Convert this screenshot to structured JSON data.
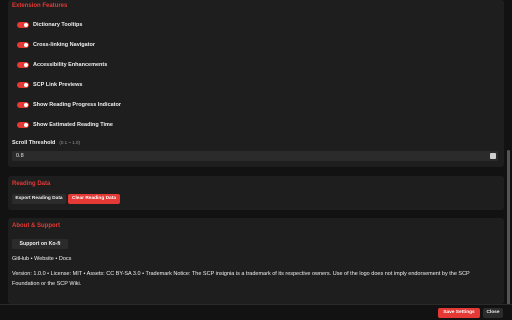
{
  "extension_features": {
    "title": "Extension Features",
    "toggles": [
      {
        "label": "Dictionary Tooltips",
        "enabled": true
      },
      {
        "label": "Cross-linking Navigator",
        "enabled": true
      },
      {
        "label": "Accessibility Enhancements",
        "enabled": true
      },
      {
        "label": "SCP Link Previews",
        "enabled": true
      },
      {
        "label": "Show Reading Progress Indicator",
        "enabled": true
      },
      {
        "label": "Show Estimated Reading Time",
        "enabled": true
      }
    ],
    "scroll_threshold": {
      "label": "Scroll Threshold",
      "hint": "(0.1 ~ 1.0)",
      "value": "0.8"
    }
  },
  "reading_data": {
    "title": "Reading Data",
    "export_label": "Export Reading Data",
    "clear_label": "Clear Reading Data"
  },
  "about": {
    "title": "About & Support",
    "kofi_label": "Support on Ko-fi",
    "links": "GitHub • Website • Docs",
    "legal": "Version: 1.0.0 • License: MIT • Assets: CC BY-SA 3.0 • Trademark Notice: The SCP insignia is a trademark of its respective owners. Use of the logo does not imply endorsement by the SCP Foundation or the SCP Wiki."
  },
  "footer": {
    "save_label": "Save Settings",
    "close_label": "Close"
  },
  "colors": {
    "accent": "#e53935",
    "background": "#121212",
    "card": "#1e1e1e"
  }
}
